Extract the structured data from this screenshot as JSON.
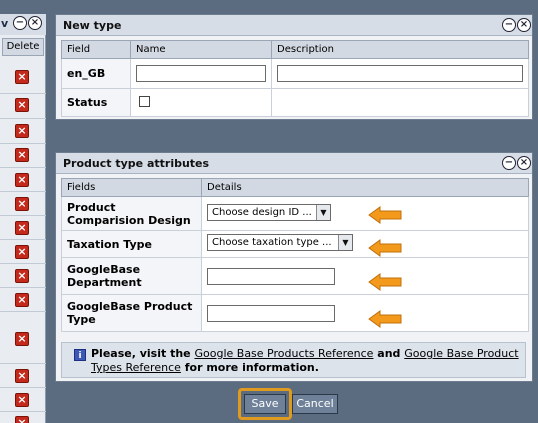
{
  "left_panel": {
    "delete_header": "Delete"
  },
  "new_type": {
    "title": "New type",
    "columns": [
      "Field",
      "Name",
      "Description"
    ],
    "rows": [
      {
        "label": "en_GB",
        "name_value": "",
        "description_value": ""
      },
      {
        "label": "Status"
      }
    ]
  },
  "product_type_attributes": {
    "title": "Product type attributes",
    "columns": [
      "Fields",
      "Details"
    ],
    "rows": [
      {
        "label": "Product Comparision Design",
        "control": "select",
        "value": "Choose design ID ..."
      },
      {
        "label": "Taxation Type",
        "control": "select",
        "value": "Choose taxation type ..."
      },
      {
        "label": "GoogleBase Department",
        "control": "text",
        "value": ""
      },
      {
        "label": "GoogleBase Product Type",
        "control": "text",
        "value": ""
      }
    ],
    "info": {
      "prefix": "Please, visit the",
      "link1": "Google Base Products Reference",
      "middle": "and",
      "link2": "Google Base Product Types Reference",
      "suffix": "for more information."
    }
  },
  "actions": {
    "save_label": "Save",
    "cancel_label": "Cancel"
  },
  "colors": {
    "background": "#5b6b80",
    "highlight": "#e09a1e",
    "arrow": "#f39a1c",
    "delete_icon": "#c32a1c"
  }
}
